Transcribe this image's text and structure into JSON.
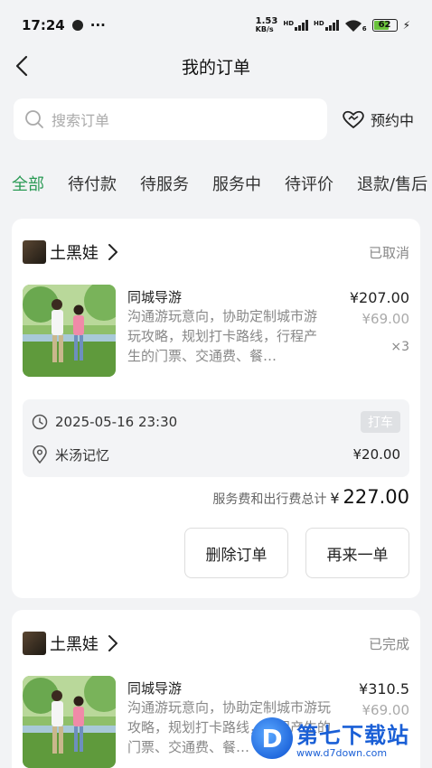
{
  "status_bar": {
    "time": "17:24",
    "more": "···",
    "net_speed_top": "1.53",
    "net_speed_unit": "KB/s",
    "sig1": "HD",
    "sig2": "HD",
    "wifi_num": "6",
    "battery": "62"
  },
  "header": {
    "title": "我的订单"
  },
  "search": {
    "placeholder": "搜索订单"
  },
  "reserve": {
    "label": "预约中"
  },
  "tabs": [
    "全部",
    "待付款",
    "待服务",
    "服务中",
    "待评价",
    "退款/售后"
  ],
  "orders": [
    {
      "shop": "土黑娃",
      "status": "已取消",
      "item": {
        "name": "同城导游",
        "desc": "沟通游玩意向，协助定制城市游玩攻略，规划打卡路线，行程产生的门票、交通费、餐…",
        "price": "¥207.00",
        "orig_price": "¥69.00",
        "qty": "×3"
      },
      "extra": {
        "time": "2025-05-16 23:30",
        "tag": "打车",
        "place": "米汤记忆",
        "place_price": "¥20.00"
      },
      "total_label": "服务费和出行费总计",
      "total_currency": "¥",
      "total_value": "227.00",
      "actions": {
        "delete": "删除订单",
        "again": "再来一单"
      }
    },
    {
      "shop": "土黑娃",
      "status": "已完成",
      "item": {
        "name": "同城导游",
        "desc": "沟通游玩意向，协助定制城市游玩攻略，规划打卡路线，行程产生的门票、交通费、餐…",
        "price": "¥310.5",
        "orig_price": "¥69.00"
      }
    }
  ],
  "watermark": {
    "logo": "D",
    "title": "第七下载站",
    "url": "www.d7down.com"
  },
  "colors": {
    "accent": "#2b9a55",
    "bg": "#f2f3f5"
  }
}
